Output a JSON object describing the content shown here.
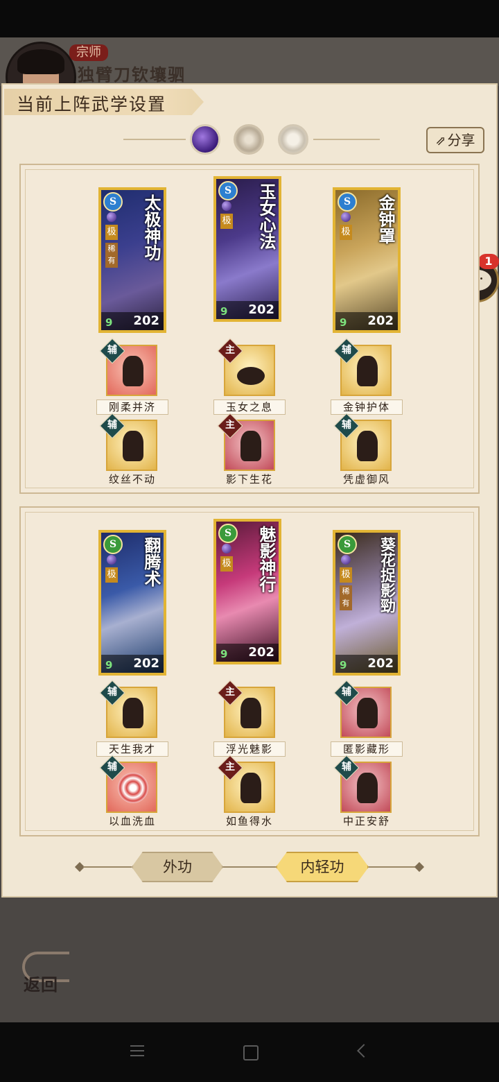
{
  "header": {
    "rank": "宗师",
    "player_name": "独臂刀钦壤驷"
  },
  "panel": {
    "title": "当前上阵武学设置",
    "share_label": "分享"
  },
  "chat": {
    "unread": "1"
  },
  "teams": [
    {
      "cards": [
        {
          "name": "太极神功",
          "badge": "S",
          "tier": "极",
          "rare": "稀有",
          "nine": "9",
          "level": "202"
        },
        {
          "name": "玉女心法",
          "badge": "S",
          "tier": "极",
          "nine": "9",
          "level": "202"
        },
        {
          "name": "金钟罩",
          "badge": "S",
          "tier": "极",
          "nine": "9",
          "level": "202"
        }
      ],
      "skills_row1": [
        {
          "tag": "辅",
          "name": "刚柔并济"
        },
        {
          "tag": "主",
          "name": "玉女之息"
        },
        {
          "tag": "辅",
          "name": "金钟护体"
        }
      ],
      "skills_row2": [
        {
          "tag": "辅",
          "name": "纹丝不动"
        },
        {
          "tag": "主",
          "name": "影下生花"
        },
        {
          "tag": "辅",
          "name": "凭虚御风"
        }
      ]
    },
    {
      "cards": [
        {
          "name": "翻腾术",
          "badge": "S",
          "tier": "极",
          "nine": "9",
          "level": "202"
        },
        {
          "name": "魅影神行",
          "badge": "S",
          "tier": "极",
          "nine": "9",
          "level": "202"
        },
        {
          "name": "葵花捉影勁",
          "badge": "S",
          "tier": "极",
          "rare": "稀有",
          "nine": "9",
          "level": "202"
        }
      ],
      "skills_row1": [
        {
          "tag": "辅",
          "name": "天生我才"
        },
        {
          "tag": "主",
          "name": "浮光魅影"
        },
        {
          "tag": "辅",
          "name": "匿影藏形"
        }
      ],
      "skills_row2": [
        {
          "tag": "辅",
          "name": "以血洗血"
        },
        {
          "tag": "主",
          "name": "如鱼得水"
        },
        {
          "tag": "辅",
          "name": "中正安舒"
        }
      ]
    }
  ],
  "tabs": {
    "outer": "外功",
    "inner": "内轻功"
  },
  "back_label": "返回"
}
